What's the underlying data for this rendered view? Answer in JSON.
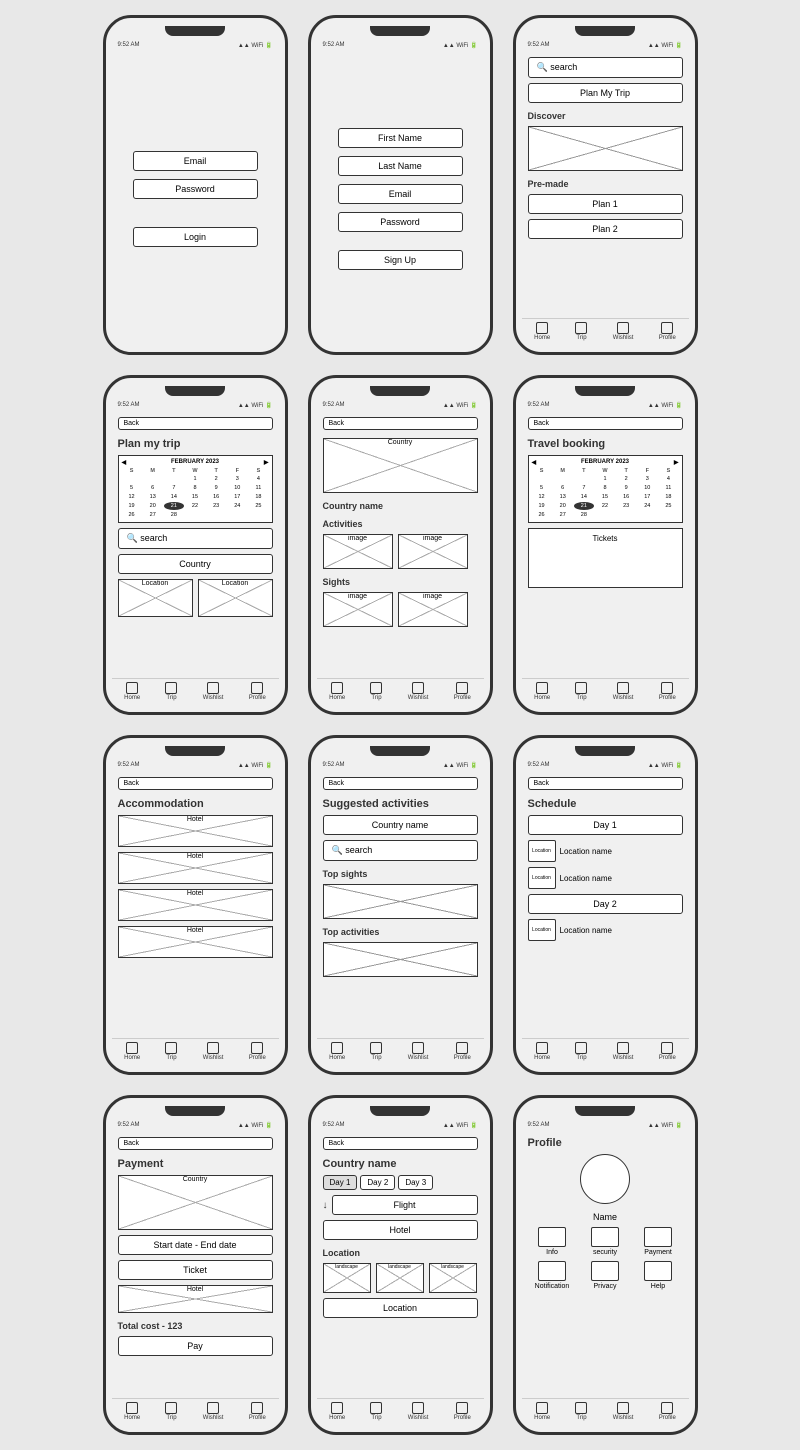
{
  "phones": [
    {
      "id": "login",
      "status": "9:52 AM",
      "fields": [
        "Email",
        "Password"
      ],
      "button": "Login",
      "hasNav": false
    },
    {
      "id": "signup",
      "status": "9:52 AM",
      "fields": [
        "First Name",
        "Last Name",
        "Email",
        "Password"
      ],
      "button": "Sign Up",
      "hasNav": false
    },
    {
      "id": "home",
      "status": "9:52 AM",
      "searchPlaceholder": "search",
      "planButton": "Plan My Trip",
      "sections": [
        "Discover",
        "Pre-made"
      ],
      "premadePlans": [
        "Plan 1",
        "Plan 2"
      ],
      "nav": [
        "Home",
        "Trip",
        "Wishlist",
        "Profile"
      ]
    },
    {
      "id": "plan-my-trip",
      "status": "9:52 AM",
      "backLabel": "Back",
      "title": "Plan my trip",
      "calMonth": "FEBRUARY 2023",
      "calDays": [
        "S",
        "M",
        "T",
        "W",
        "T",
        "F",
        "S"
      ],
      "calRows": [
        [
          "",
          "",
          "",
          "1",
          "2",
          "3",
          "4"
        ],
        [
          "5",
          "6",
          "7",
          "8",
          "9",
          "10",
          "11"
        ],
        [
          "12",
          "13",
          "14",
          "15",
          "16",
          "17",
          "18"
        ],
        [
          "19",
          "20",
          "21",
          "22",
          "23",
          "24",
          "25"
        ],
        [
          "26",
          "27",
          "28",
          "",
          "",
          "",
          ""
        ]
      ],
      "highlighted": "21",
      "searchPlaceholder": "search",
      "countryButton": "Country",
      "nav": [
        "Home",
        "Trip",
        "Wishlist",
        "Profile"
      ]
    },
    {
      "id": "country-detail",
      "status": "9:52 AM",
      "backLabel": "Back",
      "countryLabel": "Country",
      "countryName": "Country name",
      "sections": [
        "Activities",
        "Sights"
      ],
      "nav": [
        "Home",
        "Trip",
        "Wishlist",
        "Profile"
      ]
    },
    {
      "id": "travel-booking",
      "status": "9:52 AM",
      "backLabel": "Back",
      "title": "Travel booking",
      "calMonth": "FEBRUARY 2023",
      "calDays": [
        "S",
        "M",
        "T",
        "W",
        "T",
        "F",
        "S"
      ],
      "calRows": [
        [
          "",
          "",
          "",
          "1",
          "2",
          "3",
          "4"
        ],
        [
          "5",
          "6",
          "7",
          "8",
          "9",
          "10",
          "11"
        ],
        [
          "12",
          "13",
          "14",
          "15",
          "16",
          "17",
          "18"
        ],
        [
          "19",
          "20",
          "21",
          "22",
          "23",
          "24",
          "25"
        ],
        [
          "26",
          "27",
          "28",
          "",
          "",
          "",
          ""
        ]
      ],
      "highlighted": "21",
      "ticketsLabel": "Tickets",
      "nav": [
        "Home",
        "Trip",
        "Wishlist",
        "Profile"
      ]
    },
    {
      "id": "accommodation",
      "status": "9:52 AM",
      "backLabel": "Back",
      "title": "Accommodation",
      "hotels": [
        "Hotel",
        "Hotel",
        "Hotel",
        "Hotel"
      ],
      "nav": [
        "Home",
        "Trip",
        "Wishlist",
        "Profile"
      ]
    },
    {
      "id": "suggested-activities",
      "status": "9:52 AM",
      "backLabel": "Back",
      "title": "Suggested activities",
      "countryName": "Country name",
      "searchPlaceholder": "search",
      "topSightsLabel": "Top sights",
      "topActivitiesLabel": "Top activities",
      "nav": [
        "Home",
        "Trip",
        "Wishlist",
        "Profile"
      ]
    },
    {
      "id": "schedule",
      "status": "9:52 AM",
      "backLabel": "Back",
      "title": "Schedule",
      "days": [
        {
          "label": "Day 1",
          "locations": [
            "Location name",
            "Location name"
          ]
        },
        {
          "label": "Day 2",
          "locations": [
            "Location name"
          ]
        }
      ],
      "nav": [
        "Home",
        "Trip",
        "Wishlist",
        "Profile"
      ]
    },
    {
      "id": "payment",
      "status": "9:52 AM",
      "backLabel": "Back",
      "title": "Payment",
      "countryLabel": "Country",
      "dateRange": "Start date - End date",
      "ticket": "Ticket",
      "hotel": "Hotel",
      "totalCost": "Total cost - 123",
      "payButton": "Pay",
      "nav": [
        "Home",
        "Trip",
        "Wishlist",
        "Profile"
      ]
    },
    {
      "id": "itinerary",
      "status": "9:52 AM",
      "backLabel": "Back",
      "title": "Country name",
      "tabs": [
        "Day 1",
        "Day 2",
        "Day 3"
      ],
      "items": [
        "Flight",
        "Hotel",
        "Location",
        "Location"
      ],
      "nav": [
        "Home",
        "Trip",
        "Wishlist",
        "Profile"
      ]
    },
    {
      "id": "profile",
      "status": "9:52 AM",
      "title": "Profile",
      "name": "Name",
      "menuItems": [
        [
          "Info",
          "security",
          "Payment"
        ],
        [
          "Notification",
          "Privacy",
          "Help"
        ]
      ],
      "nav": [
        "Home",
        "Trip",
        "Wishlist",
        "Profile"
      ]
    }
  ],
  "nav": {
    "items": [
      "Home",
      "Trip",
      "Wishlist",
      "Profile"
    ]
  }
}
